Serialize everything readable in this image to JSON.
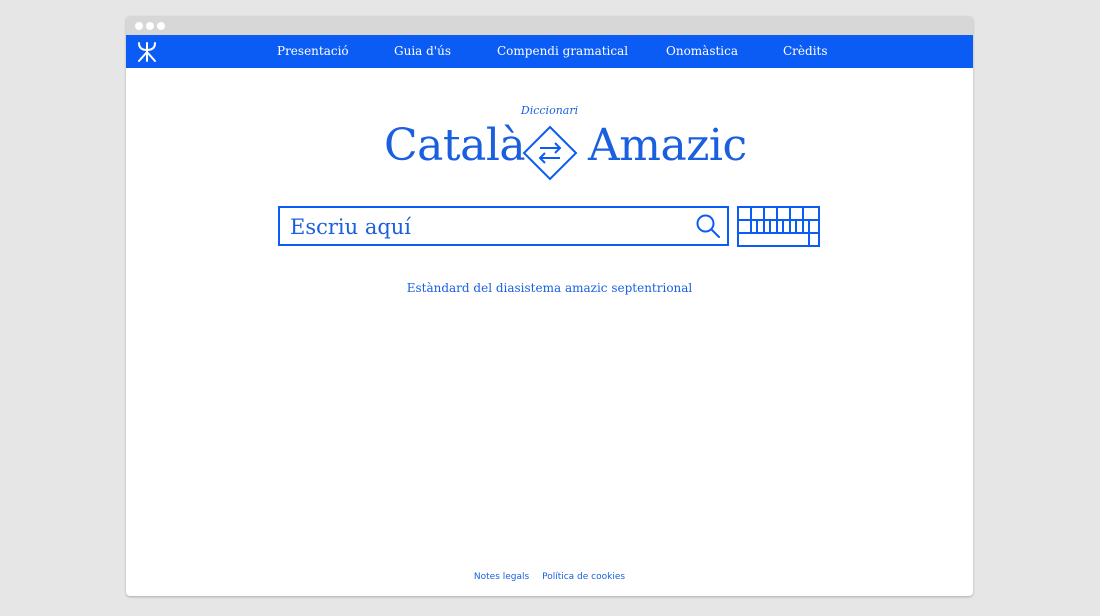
{
  "nav": {
    "items": [
      {
        "label": "Presentació"
      },
      {
        "label": "Guia d'ús"
      },
      {
        "label": "Compendi gramatical"
      },
      {
        "label": "Onomàstica"
      },
      {
        "label": "Crèdits"
      }
    ]
  },
  "header": {
    "subtitle": "Diccionari",
    "title_left": "Català",
    "title_right": "Amazic"
  },
  "search": {
    "placeholder": "Escriu aquí"
  },
  "main": {
    "standard_link": "Estàndard del diasistema amazic septentrional"
  },
  "footer": {
    "links": [
      {
        "label": "Notes legals"
      },
      {
        "label": "Política de cookies"
      }
    ]
  },
  "colors": {
    "accent": "#0a5cf5",
    "text": "#1a5fe0",
    "chrome": "#d7d7d7",
    "background": "#e6e6e6"
  },
  "icons": {
    "logo": "yaz-logo-icon",
    "swap": "swap-arrows-icon",
    "search": "search-icon",
    "keyboard": "keyboard-icon"
  }
}
